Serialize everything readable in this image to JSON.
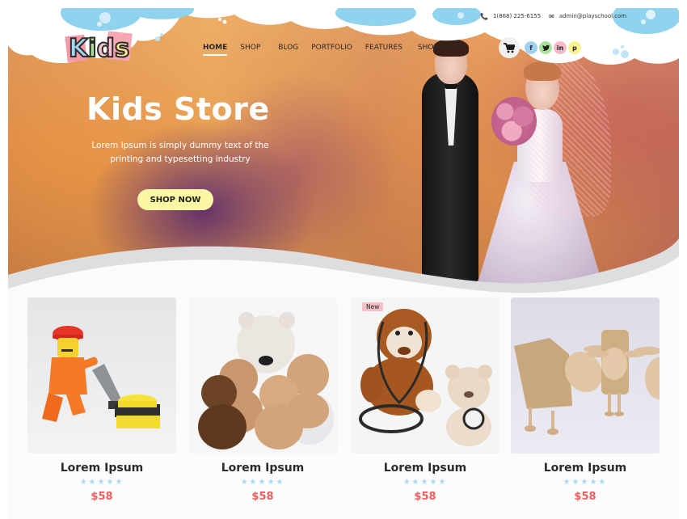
{
  "brand": {
    "logo_letters": [
      "K",
      "i",
      "d",
      "s"
    ]
  },
  "topbar": {
    "phone": "1(868) 225-6155",
    "email": "admin@playschool.com",
    "phone_icon": "phone-icon",
    "email_icon": "envelope-icon"
  },
  "nav": {
    "items": [
      {
        "label": "HOME",
        "active": true
      },
      {
        "label": "SHOP",
        "active": false
      },
      {
        "label": "BLOG",
        "active": false
      },
      {
        "label": "PORTFOLIO",
        "active": false
      },
      {
        "label": "FEATURES",
        "active": false
      },
      {
        "label": "SHORTCODES",
        "active": false
      }
    ],
    "cart_icon": "cart-icon"
  },
  "social": [
    {
      "name": "facebook-icon",
      "glyph": "f",
      "color": "#9fd2f2"
    },
    {
      "name": "twitter-icon",
      "glyph": "🐦",
      "color": "#a9e39a"
    },
    {
      "name": "linkedin-icon",
      "glyph": "in",
      "color": "#f8b9c6"
    },
    {
      "name": "pinterest-icon",
      "glyph": "p",
      "color": "#f8f28f"
    }
  ],
  "hero": {
    "title": "Kids Store",
    "subtitle_line1": "Lorem Ipsum is simply dummy text of the",
    "subtitle_line2": "printing and typesetting industry",
    "cta": "SHOP NOW"
  },
  "products": [
    {
      "title": "Lorem Ipsum",
      "price": "$58",
      "rating": 5,
      "stars": "★★★★★",
      "badge": null,
      "image": "lego-figure-floor-polisher"
    },
    {
      "title": "Lorem Ipsum",
      "price": "$58",
      "rating": 5,
      "stars": "★★★★★",
      "badge": null,
      "image": "teddy-bears-group"
    },
    {
      "title": "Lorem Ipsum",
      "price": "$58",
      "rating": 5,
      "stars": "★★★★★",
      "badge": "New",
      "image": "monkey-plush-stethoscope"
    },
    {
      "title": "Lorem Ipsum",
      "price": "$58",
      "rating": 5,
      "stars": "★★★★★",
      "badge": null,
      "image": "wooden-sheep-toys"
    }
  ],
  "colors": {
    "accent_yellow": "#fbf7a4",
    "price_red": "#ee5e5a",
    "star_blue": "#a8dcf4",
    "cloud_blue": "#8fd3ef",
    "badge_pink": "#f7c0c8"
  }
}
